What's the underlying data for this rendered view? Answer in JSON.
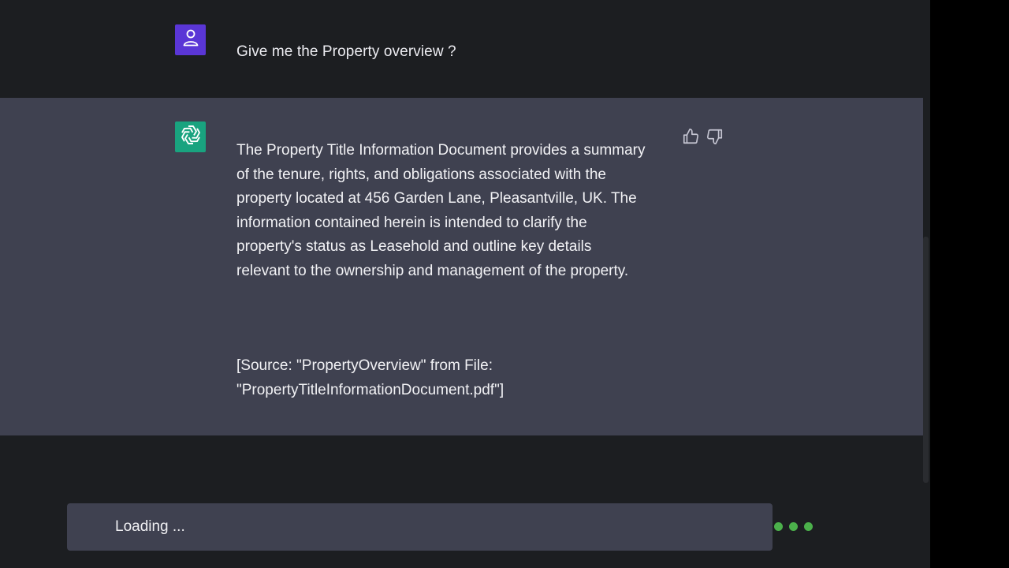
{
  "user_message": {
    "avatar_icon": "user-icon",
    "avatar_color": "#5a36d6",
    "text": "Give me the Property overview ?"
  },
  "assistant_message": {
    "avatar_icon": "openai-logo-icon",
    "avatar_color": "#19a37f",
    "paragraph": "The Property Title Information Document provides a summary of the tenure, rights, and obligations associated with the property located at 456 Garden Lane, Pleasantville, UK. The information contained herein is intended to clarify the property's status as Leasehold and outline key details relevant to the ownership and management of the property.",
    "source": "[Source: \"PropertyOverview\" from File: \"PropertyTitleInformationDocument.pdf\"]",
    "feedback": {
      "up_icon": "thumbs-up-icon",
      "down_icon": "thumbs-down-icon"
    }
  },
  "loading": {
    "text": "Loading  ...",
    "indicator_color": "#4bb04b"
  }
}
